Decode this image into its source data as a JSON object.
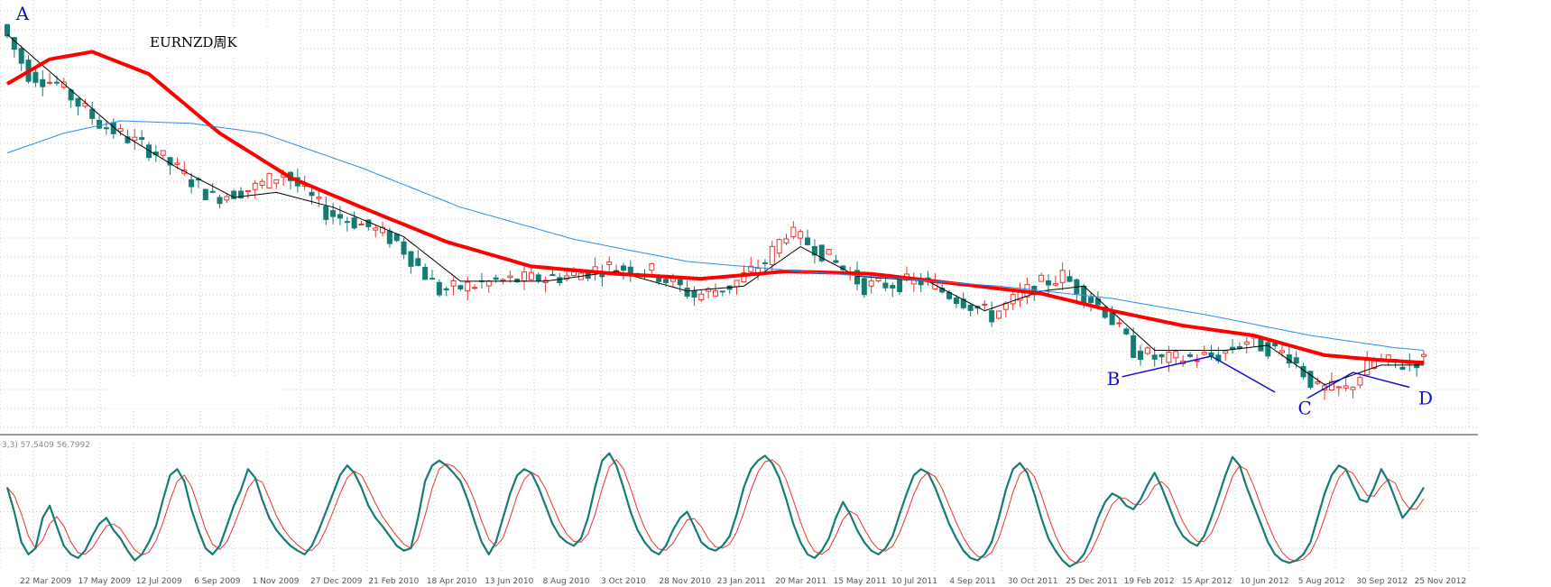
{
  "title": "EURNZD周K",
  "oscillator_label": "3,3) 57.5409 56.7992",
  "colors": {
    "bull_candle": "#e8352e",
    "bear_candle": "#137d74",
    "ma_fast": "#000000",
    "ma_mid": "#ff0000",
    "ma_slow": "#2f8be6",
    "osc_main": "#177b73",
    "osc_signal": "#e8352e",
    "annotation": "#1010cc",
    "grid": "#c8c8c8"
  },
  "chart_data": {
    "type": "candlestick",
    "instrument": "EURNZD",
    "timeframe": "weekly",
    "x_tick_labels": [
      "22 Mar 2009",
      "17 May 2009",
      "12 Jul 2009",
      "6 Sep 2009",
      "1 Nov 2009",
      "27 Dec 2009",
      "21 Feb 2010",
      "18 Apr 2010",
      "13 Jun 2010",
      "8 Aug 2010",
      "3 Oct 2010",
      "28 Nov 2010",
      "23 Jan 2011",
      "20 Mar 2011",
      "15 May 2011",
      "10 Jul 2011",
      "4 Sep 2011",
      "30 Oct 2011",
      "25 Dec 2011",
      "19 Feb 2012",
      "15 Apr 2012",
      "10 Jun 2012",
      "5 Aug 2012",
      "30 Sep 2012",
      "25 Nov 2012"
    ],
    "price_path": [
      {
        "x": 0,
        "y": 2.4
      },
      {
        "x": 4,
        "y": 2.3
      },
      {
        "x": 8,
        "y": 2.28
      },
      {
        "x": 14,
        "y": 2.2
      },
      {
        "x": 22,
        "y": 2.14
      },
      {
        "x": 30,
        "y": 2.05
      },
      {
        "x": 36,
        "y": 2.07
      },
      {
        "x": 40,
        "y": 2.1
      },
      {
        "x": 46,
        "y": 2.02
      },
      {
        "x": 52,
        "y": 1.99
      },
      {
        "x": 56,
        "y": 1.96
      },
      {
        "x": 62,
        "y": 1.86
      },
      {
        "x": 70,
        "y": 1.88
      },
      {
        "x": 80,
        "y": 1.89
      },
      {
        "x": 86,
        "y": 1.91
      },
      {
        "x": 92,
        "y": 1.9
      },
      {
        "x": 98,
        "y": 1.85
      },
      {
        "x": 103,
        "y": 1.87
      },
      {
        "x": 108,
        "y": 1.92
      },
      {
        "x": 111,
        "y": 1.98
      },
      {
        "x": 115,
        "y": 1.95
      },
      {
        "x": 122,
        "y": 1.87
      },
      {
        "x": 130,
        "y": 1.88
      },
      {
        "x": 136,
        "y": 1.84
      },
      {
        "x": 140,
        "y": 1.81
      },
      {
        "x": 146,
        "y": 1.87
      },
      {
        "x": 150,
        "y": 1.89
      },
      {
        "x": 156,
        "y": 1.82
      },
      {
        "x": 160,
        "y": 1.74
      },
      {
        "x": 164,
        "y": 1.72
      },
      {
        "x": 172,
        "y": 1.73
      },
      {
        "x": 176,
        "y": 1.76
      },
      {
        "x": 182,
        "y": 1.73
      },
      {
        "x": 186,
        "y": 1.66
      },
      {
        "x": 190,
        "y": 1.66
      },
      {
        "x": 194,
        "y": 1.72
      },
      {
        "x": 198,
        "y": 1.71
      },
      {
        "x": 200,
        "y": 1.72
      }
    ],
    "series": [
      {
        "name": "ma_fast",
        "values": [
          {
            "x": 0,
            "y": 2.38
          },
          {
            "x": 8,
            "y": 2.28
          },
          {
            "x": 16,
            "y": 2.18
          },
          {
            "x": 24,
            "y": 2.11
          },
          {
            "x": 32,
            "y": 2.05
          },
          {
            "x": 38,
            "y": 2.06
          },
          {
            "x": 46,
            "y": 2.03
          },
          {
            "x": 56,
            "y": 1.97
          },
          {
            "x": 64,
            "y": 1.88
          },
          {
            "x": 76,
            "y": 1.88
          },
          {
            "x": 86,
            "y": 1.9
          },
          {
            "x": 96,
            "y": 1.86
          },
          {
            "x": 104,
            "y": 1.87
          },
          {
            "x": 112,
            "y": 1.95
          },
          {
            "x": 120,
            "y": 1.89
          },
          {
            "x": 130,
            "y": 1.88
          },
          {
            "x": 138,
            "y": 1.82
          },
          {
            "x": 146,
            "y": 1.86
          },
          {
            "x": 152,
            "y": 1.87
          },
          {
            "x": 162,
            "y": 1.74
          },
          {
            "x": 172,
            "y": 1.74
          },
          {
            "x": 178,
            "y": 1.75
          },
          {
            "x": 186,
            "y": 1.67
          },
          {
            "x": 194,
            "y": 1.71
          },
          {
            "x": 200,
            "y": 1.71
          }
        ]
      },
      {
        "name": "ma_mid",
        "values": [
          {
            "x": 0,
            "y": 2.28
          },
          {
            "x": 6,
            "y": 2.33
          },
          {
            "x": 12,
            "y": 2.345
          },
          {
            "x": 20,
            "y": 2.3
          },
          {
            "x": 30,
            "y": 2.18
          },
          {
            "x": 40,
            "y": 2.09
          },
          {
            "x": 50,
            "y": 2.03
          },
          {
            "x": 62,
            "y": 1.96
          },
          {
            "x": 74,
            "y": 1.91
          },
          {
            "x": 86,
            "y": 1.895
          },
          {
            "x": 98,
            "y": 1.885
          },
          {
            "x": 110,
            "y": 1.9
          },
          {
            "x": 122,
            "y": 1.895
          },
          {
            "x": 134,
            "y": 1.875
          },
          {
            "x": 146,
            "y": 1.855
          },
          {
            "x": 156,
            "y": 1.82
          },
          {
            "x": 166,
            "y": 1.79
          },
          {
            "x": 176,
            "y": 1.77
          },
          {
            "x": 186,
            "y": 1.73
          },
          {
            "x": 194,
            "y": 1.72
          },
          {
            "x": 200,
            "y": 1.715
          }
        ]
      },
      {
        "name": "ma_slow",
        "values": [
          {
            "x": 0,
            "y": 2.14
          },
          {
            "x": 8,
            "y": 2.18
          },
          {
            "x": 16,
            "y": 2.205
          },
          {
            "x": 26,
            "y": 2.2
          },
          {
            "x": 36,
            "y": 2.18
          },
          {
            "x": 50,
            "y": 2.11
          },
          {
            "x": 64,
            "y": 2.03
          },
          {
            "x": 80,
            "y": 1.965
          },
          {
            "x": 96,
            "y": 1.92
          },
          {
            "x": 112,
            "y": 1.9
          },
          {
            "x": 126,
            "y": 1.885
          },
          {
            "x": 140,
            "y": 1.87
          },
          {
            "x": 156,
            "y": 1.845
          },
          {
            "x": 170,
            "y": 1.81
          },
          {
            "x": 184,
            "y": 1.77
          },
          {
            "x": 196,
            "y": 1.745
          },
          {
            "x": 200,
            "y": 1.74
          }
        ]
      }
    ],
    "annotations": [
      {
        "label": "A",
        "x": 2,
        "y": 2.41
      },
      {
        "label": "B",
        "x": 156,
        "y": 1.67
      },
      {
        "label": "C",
        "x": 183,
        "y": 1.61
      },
      {
        "label": "D",
        "x": 200,
        "y": 1.63
      }
    ],
    "trend_lines": [
      {
        "from": {
          "x": 157,
          "y": 1.685
        },
        "to": {
          "x": 170,
          "y": 1.728
        }
      },
      {
        "from": {
          "x": 170,
          "y": 1.728
        },
        "to": {
          "x": 179,
          "y": 1.655
        }
      },
      {
        "from": {
          "x": 182,
          "y": 1.63
        },
        "to": {
          "x": 190,
          "y": 1.695
        }
      },
      {
        "from": {
          "x": 190,
          "y": 1.695
        },
        "to": {
          "x": 198,
          "y": 1.665
        }
      }
    ],
    "oscillator": {
      "range": [
        0,
        100
      ],
      "main": [
        70,
        50,
        25,
        15,
        20,
        45,
        55,
        38,
        22,
        15,
        12,
        18,
        30,
        40,
        45,
        35,
        28,
        18,
        10,
        15,
        25,
        38,
        60,
        80,
        85,
        75,
        52,
        35,
        20,
        15,
        22,
        38,
        55,
        68,
        85,
        78,
        60,
        45,
        35,
        28,
        22,
        18,
        15,
        22,
        35,
        50,
        65,
        80,
        88,
        82,
        70,
        55,
        45,
        38,
        30,
        22,
        18,
        20,
        45,
        75,
        88,
        92,
        88,
        82,
        75,
        60,
        42,
        25,
        15,
        25,
        45,
        65,
        80,
        85,
        82,
        70,
        55,
        40,
        30,
        25,
        22,
        28,
        45,
        70,
        92,
        98,
        88,
        70,
        50,
        35,
        25,
        18,
        15,
        22,
        35,
        45,
        50,
        38,
        25,
        20,
        18,
        22,
        30,
        48,
        70,
        85,
        92,
        96,
        90,
        78,
        60,
        40,
        25,
        15,
        12,
        18,
        28,
        45,
        58,
        48,
        35,
        25,
        18,
        15,
        20,
        30,
        48,
        65,
        80,
        85,
        82,
        70,
        55,
        40,
        28,
        18,
        12,
        10,
        15,
        25,
        45,
        68,
        85,
        90,
        82,
        65,
        45,
        28,
        18,
        10,
        5,
        8,
        15,
        28,
        45,
        58,
        65,
        62,
        55,
        52,
        60,
        72,
        82,
        70,
        55,
        40,
        30,
        25,
        22,
        30,
        45,
        62,
        80,
        95,
        88,
        70,
        55,
        40,
        25,
        15,
        10,
        8,
        10,
        15,
        25,
        45,
        65,
        80,
        88,
        85,
        72,
        60,
        58,
        70,
        85,
        75,
        60,
        45,
        52,
        60,
        70
      ]
    }
  }
}
